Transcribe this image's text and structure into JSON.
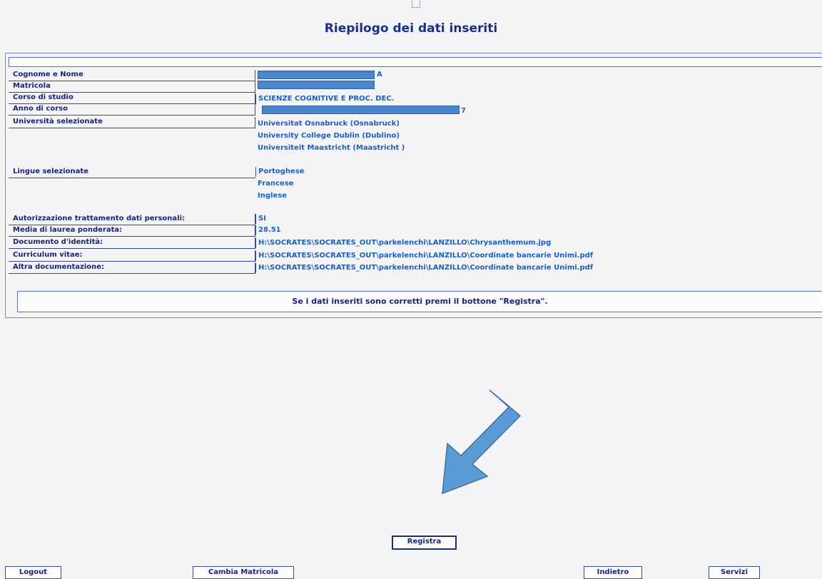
{
  "title": "Riepilogo dei dati inseriti",
  "fields": {
    "cognome_nome": {
      "label": "Cognome e Nome",
      "value": "A"
    },
    "matricola": {
      "label": "Matricola",
      "value": ""
    },
    "corso": {
      "label": "Corso di studio",
      "value": "SCIENZE COGNITIVE E PROC. DEC."
    },
    "anno": {
      "label": "Anno di corso",
      "value": "7"
    },
    "universita": {
      "label": "Università selezionate",
      "values": [
        "Universitat Osnabruck (Osnabruck)",
        "University College Dublin (Dublino)",
        "Universiteit Maastricht (Maastricht )"
      ]
    },
    "lingue": {
      "label": "Lingue selezionate",
      "values": [
        "Portoghese",
        "Francese",
        "Inglese"
      ]
    },
    "autorizzazione": {
      "label": "Autorizzazione trattamento dati personali:",
      "value": "SI"
    },
    "media": {
      "label": "Media di laurea ponderata:",
      "value": "28.51"
    },
    "documento": {
      "label": "Documento d'identità:",
      "value": "H:\\SOCRATES\\SOCRATES_OUT\\parkelenchi\\LANZILLO\\Chrysanthemum.jpg"
    },
    "curriculum": {
      "label": "Curriculum vitae:",
      "value": "H:\\SOCRATES\\SOCRATES_OUT\\parkelenchi\\LANZILLO\\Coordinate bancarie Unimi.pdf"
    },
    "altra": {
      "label": "Altra documentazione:",
      "value": "H:\\SOCRATES\\SOCRATES_OUT\\parkelenchi\\LANZILLO\\Coordinate bancarie Unimi.pdf"
    }
  },
  "notice": "Se i dati inseriti sono corretti premi il bottone \"Registra\".",
  "buttons": {
    "registra": "Registra",
    "logout": "Logout",
    "cambia_matricola": "Cambia Matricola",
    "indietro": "Indietro",
    "servizi": "Servizi"
  },
  "colors": {
    "accent": "#1a2f88",
    "value_text": "#1b5fbf",
    "arrow": "#5b9bd5"
  },
  "icons": {
    "arrow": "arrow-down-left-icon"
  }
}
